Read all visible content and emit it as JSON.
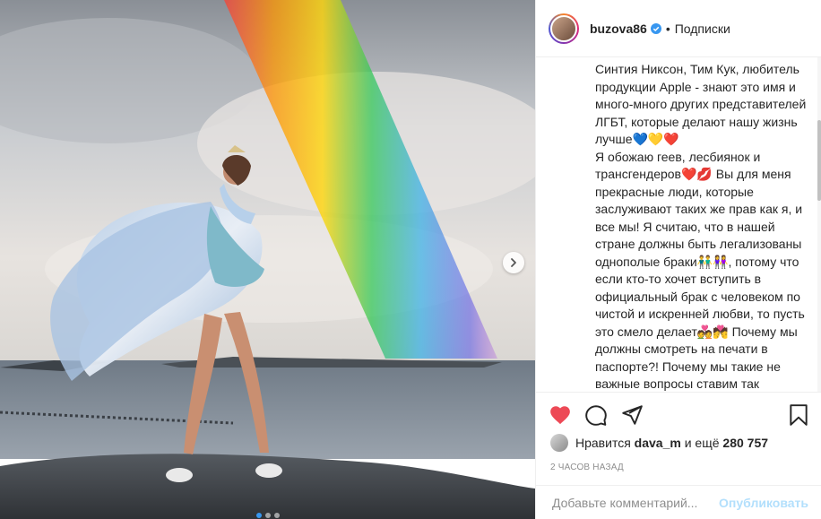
{
  "post": {
    "username": "buzova86",
    "separator": "•",
    "follow_label": "Подписки",
    "caption": "Синтия Никсон, Тим Кук, любитель продукции Apple - знают это имя и много-много других представителей ЛГБТ, которые делают нашу жизнь лучше💙💛❤️\nЯ обожаю геев, лесбиянок и трансгендеров❤️💋 Вы для меня прекрасные люди, которые заслуживают таких же прав как я, и все мы! Я считаю, что в нашей стране должны быть легализованы однополые браки👬👭, потому что если кто-то хочет вступить в официальный брак с человеком по чистой и искренней любви, то пусть это смело делает💑💏 Почему мы должны смотреть на печати в паспорте?! Почему мы такие не важные вопросы ставим так высоко? 🤔Это всего лишь печать в личном документе, выражающая нашей",
    "likes": {
      "prefix": "Нравится",
      "user": "dava_m",
      "connector": "и ещё",
      "count": "280 757"
    },
    "time_ago": "2 ЧАСОВ НАЗАД",
    "comment_placeholder": "Добавьте комментарий...",
    "publish_label": "Опубликовать"
  },
  "carousel": {
    "dot_count": 3,
    "active_index": 0
  },
  "icons": {
    "verified": "verified-badge-icon",
    "like": "heart-icon",
    "comment": "comment-icon",
    "share": "share-icon",
    "save": "bookmark-icon",
    "next": "chevron-right-icon"
  },
  "colors": {
    "like_red": "#ed4956",
    "verified_blue": "#3897f0",
    "publish_disabled": "#b2dffc"
  }
}
